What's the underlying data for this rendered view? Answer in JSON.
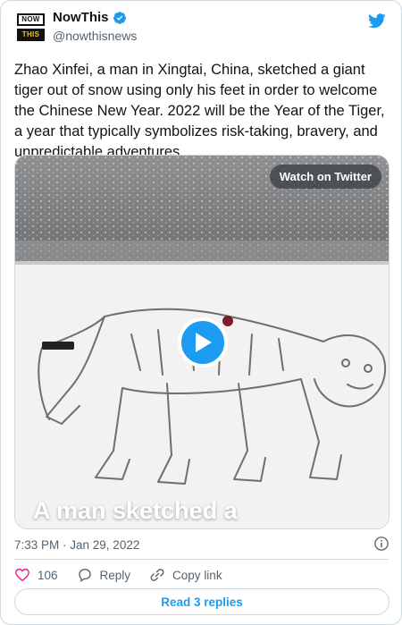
{
  "author": {
    "display_name": "NowThis",
    "handle": "@nowthisnews",
    "logo_top": "NOW",
    "logo_bottom": "THIS",
    "verified": true
  },
  "tweet": {
    "text": "Zhao Xinfei, a man in Xingtai, China, sketched a giant tiger out of snow using only his feet in order to welcome the Chinese New Year. 2022 will be the Year of the Tiger, a year that typically symbolizes risk-taking, bravery, and unpredictable adventures.",
    "timestamp": "7:33 PM · Jan 29, 2022"
  },
  "media": {
    "watch_label": "Watch on Twitter",
    "caption": "A man sketched a"
  },
  "actions": {
    "likes": "106",
    "reply_label": "Reply",
    "copy_link_label": "Copy link"
  },
  "footer": {
    "read_replies_label": "Read 3 replies"
  },
  "colors": {
    "accent": "#1d9bf0",
    "like": "#f91880",
    "text_secondary": "#536471",
    "border": "#cfd9de"
  },
  "icons": [
    "verified-badge-icon",
    "twitter-bird-icon",
    "play-icon",
    "info-icon",
    "heart-icon",
    "reply-icon",
    "link-icon"
  ]
}
